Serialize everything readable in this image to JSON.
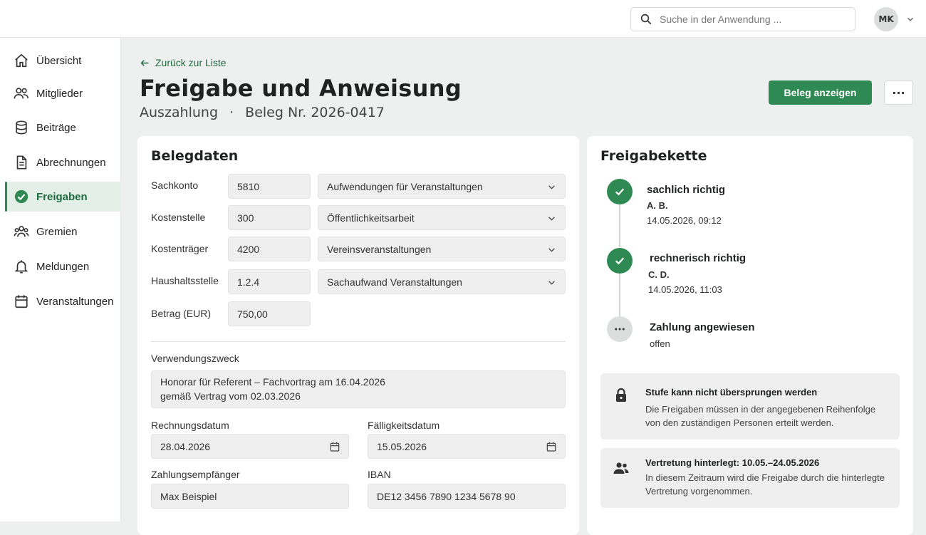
{
  "header": {
    "search_placeholder": "Suche in der Anwendung ...",
    "user_initials": "MK"
  },
  "sidebar": {
    "items": [
      {
        "label": "Übersicht",
        "icon": "home-icon"
      },
      {
        "label": "Mitglieder",
        "icon": "users-icon"
      },
      {
        "label": "Beiträge",
        "icon": "database-icon"
      },
      {
        "label": "Abrechnungen",
        "icon": "document-icon"
      },
      {
        "label": "Freigaben",
        "icon": "check-circle-icon",
        "active": true
      },
      {
        "label": "Gremien",
        "icon": "group-icon"
      },
      {
        "label": "Meldungen",
        "icon": "bell-icon"
      },
      {
        "label": "Veranstaltungen",
        "icon": "calendar-icon"
      }
    ]
  },
  "page": {
    "back_label": "Zurück zur Liste",
    "title": "Freigabe und Anweisung",
    "subtitle_type": "Auszahlung",
    "subtitle_separator": "·",
    "subtitle_beleg": "Beleg Nr. 2026-0417",
    "primary_button": "Beleg anzeigen",
    "more_button": "···"
  },
  "belegdaten": {
    "heading": "Belegdaten",
    "rows": [
      {
        "label": "Sachkonto",
        "code": "5810",
        "select": "Aufwendungen für Veranstaltungen"
      },
      {
        "label": "Kostenstelle",
        "code": "300",
        "select": "Öffentlichkeitsarbeit"
      },
      {
        "label": "Kostenträger",
        "code": "4200",
        "select": "Vereinsveranstaltungen"
      },
      {
        "label": "Haushaltsstelle",
        "code": "1.2.4",
        "select": "Sachaufwand Veranstaltungen"
      },
      {
        "label": "Betrag (EUR)",
        "code": "750,00"
      }
    ],
    "verwendungszweck_label": "Verwendungszweck",
    "verwendungszweck_line1": "Honorar für Referent – Fachvortrag am 16.04.2026",
    "verwendungszweck_line2": "gemäß Vertrag vom 02.03.2026",
    "rechnungsdatum_label": "Rechnungsdatum",
    "rechnungsdatum": "28.04.2026",
    "faelligkeitsdatum_label": "Fälligkeitsdatum",
    "faelligkeitsdatum": "15.05.2026",
    "empfaenger_label": "Zahlungsempfänger",
    "empfaenger": "Max Beispiel",
    "iban_label": "IBAN",
    "iban": "DE12 3456 7890 1234 5678 90"
  },
  "freigabekette": {
    "heading": "Freigabekette",
    "steps": [
      {
        "title": "sachlich richtig",
        "person": "A. B.",
        "date": "14.05.2026, 09:12",
        "status": "done"
      },
      {
        "title": "rechnerisch richtig",
        "person": "C. D.",
        "date": "14.05.2026, 11:03",
        "status": "done"
      },
      {
        "title": "Zahlung angewiesen",
        "state": "offen",
        "status": "open"
      }
    ],
    "notice1_title": "Stufe kann nicht übersprungen werden",
    "notice1_line1": "Die Freigaben müssen in der angegebenen Reihenfolge",
    "notice1_line2": "von den zuständigen Personen erteilt werden.",
    "notice2_title": "Vertretung hinterlegt: 10.05.–24.05.2026",
    "notice2_line1": "In diesem Zeitraum wird die Freigabe durch die hinterlegte",
    "notice2_line2": "Vertretung vorgenommen."
  },
  "colors": {
    "accent": "#2e8a52",
    "accent_dark": "#1d6b3f",
    "background": "#eef0ef"
  }
}
